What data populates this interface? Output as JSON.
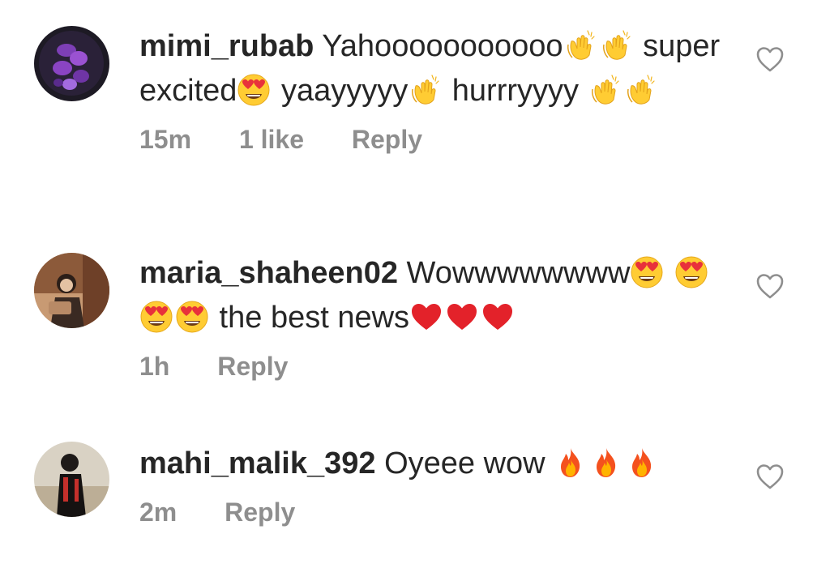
{
  "comments": [
    {
      "username": "mimi_rubab",
      "segments": [
        {
          "text": "Yahooooooooooo"
        },
        {
          "emoji": "clap"
        },
        {
          "emoji": "clap"
        },
        {
          "text": " super excited"
        },
        {
          "emoji": "heart-eyes"
        },
        {
          "text": " yaayyyyy"
        },
        {
          "emoji": "clap"
        },
        {
          "text": " hurrryyyy "
        },
        {
          "emoji": "clap"
        },
        {
          "emoji": "clap"
        }
      ],
      "time": "15m",
      "likes": "1 like",
      "reply_label": "Reply"
    },
    {
      "username": "maria_shaheen02",
      "segments": [
        {
          "text": "Wowwwwwwww"
        },
        {
          "emoji": "heart-eyes"
        },
        {
          "text": " "
        },
        {
          "emoji": "heart-eyes"
        },
        {
          "emoji": "heart-eyes"
        },
        {
          "emoji": "heart-eyes"
        },
        {
          "text": " the best news"
        },
        {
          "emoji": "red-heart"
        },
        {
          "emoji": "red-heart"
        },
        {
          "emoji": "red-heart"
        }
      ],
      "time": "1h",
      "likes": "",
      "reply_label": "Reply"
    },
    {
      "username": "mahi_malik_392",
      "segments": [
        {
          "text": "Oyeee wow "
        },
        {
          "emoji": "fire"
        },
        {
          "emoji": "fire"
        },
        {
          "emoji": "fire"
        }
      ],
      "time": "2m",
      "likes": "",
      "reply_label": "Reply"
    }
  ],
  "icons": {
    "like": "heart-outline-icon"
  },
  "colors": {
    "username": "#262626",
    "text": "#262626",
    "meta": "#8e8e8e",
    "heart_outline": "#8e8e8e"
  }
}
